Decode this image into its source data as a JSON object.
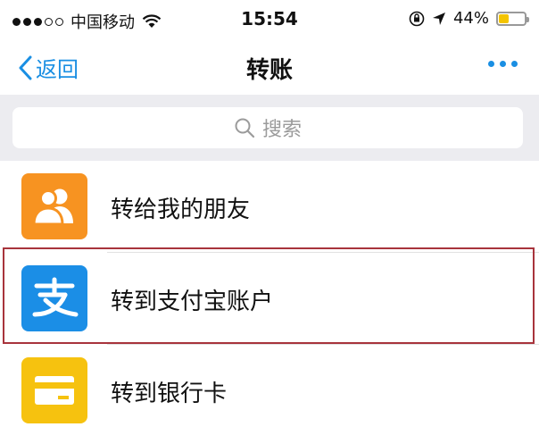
{
  "status_bar": {
    "carrier": "中国移动",
    "time": "15:54",
    "battery_percent": "44%",
    "battery_level": 0.44,
    "battery_color": "#f4c400",
    "signal_filled": 3,
    "signal_total": 5
  },
  "nav": {
    "back_label": "返回",
    "title": "转账",
    "accent_color": "#1a8fe3"
  },
  "search": {
    "placeholder": "搜索"
  },
  "list": {
    "items": [
      {
        "label": "转给我的朋友",
        "icon": "friends-icon",
        "icon_color": "#f79321"
      },
      {
        "label": "转到支付宝账户",
        "icon": "alipay-icon",
        "icon_color": "#1b8ee6",
        "highlighted": true
      },
      {
        "label": "转到银行卡",
        "icon": "bank-card-icon",
        "icon_color": "#f6c20f"
      }
    ]
  }
}
